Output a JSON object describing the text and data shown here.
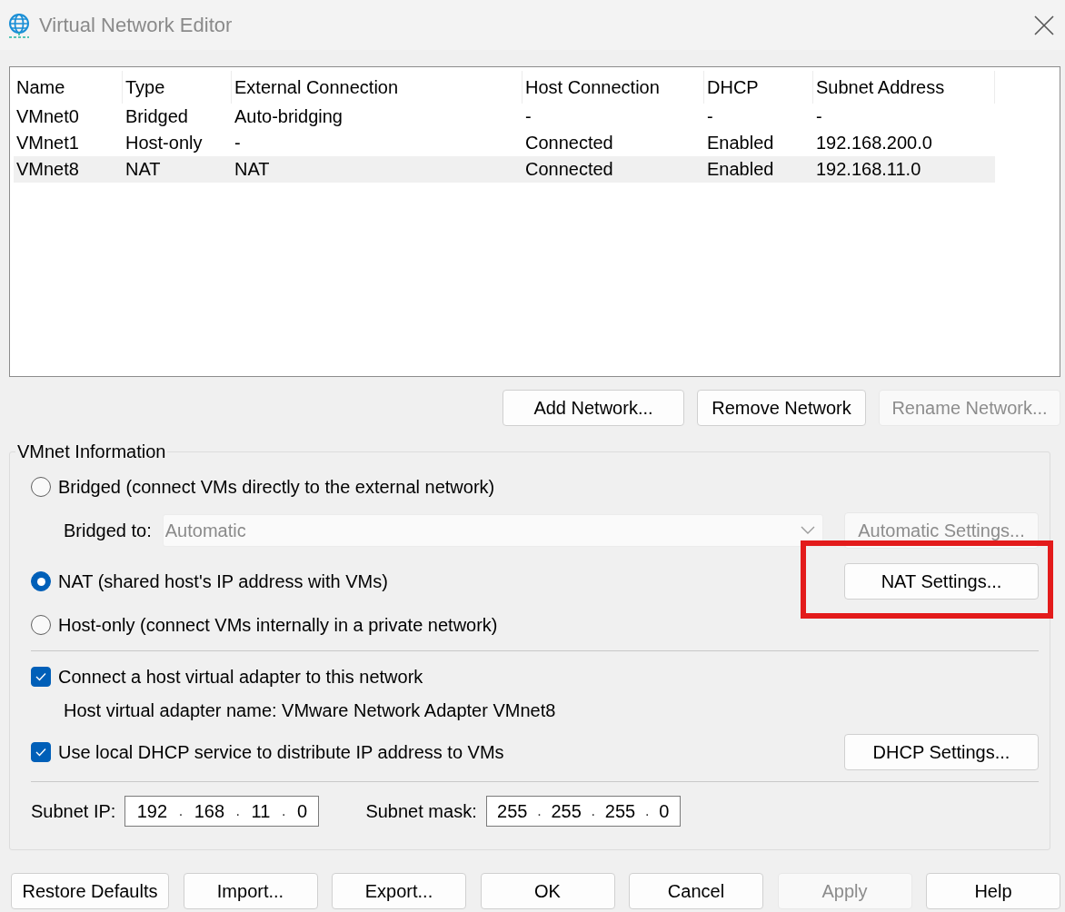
{
  "window": {
    "title": "Virtual Network Editor"
  },
  "networks": {
    "columns": [
      "Name",
      "Type",
      "External Connection",
      "Host Connection",
      "DHCP",
      "Subnet Address"
    ],
    "rows": [
      {
        "cells": [
          "VMnet0",
          "Bridged",
          "Auto-bridging",
          "-",
          "-",
          "-"
        ],
        "selected": false
      },
      {
        "cells": [
          "VMnet1",
          "Host-only",
          "-",
          "Connected",
          "Enabled",
          "192.168.200.0"
        ],
        "selected": false
      },
      {
        "cells": [
          "VMnet8",
          "NAT",
          "NAT",
          "Connected",
          "Enabled",
          "192.168.11.0"
        ],
        "selected": true
      }
    ]
  },
  "network_buttons": [
    {
      "label": "Add Network...",
      "disabled": false
    },
    {
      "label": "Remove Network",
      "disabled": false
    },
    {
      "label": "Rename Network...",
      "disabled": true
    }
  ],
  "vmnet_information": {
    "title": "VMnet Information",
    "modes": [
      {
        "kind": "bridged",
        "label": "Bridged (connect VMs directly to the external network)",
        "selected": false
      },
      {
        "kind": "nat",
        "label": "NAT (shared host's IP address with VMs)",
        "selected": true
      },
      {
        "kind": "host_only",
        "label": "Host-only (connect VMs internally in a private network)",
        "selected": false
      }
    ],
    "bridged_to": {
      "label": "Bridged to:",
      "value": "Automatic",
      "disabled": true
    },
    "automatic_settings_button": {
      "label": "Automatic Settings...",
      "disabled": true
    },
    "nat_settings_button": {
      "label": "NAT Settings...",
      "disabled": false,
      "highlighted": true
    },
    "connect_host_adapter": {
      "label": "Connect a host virtual adapter to this network",
      "checked": true
    },
    "adapter_name": "Host virtual adapter name: VMware Network Adapter VMnet8",
    "use_dhcp": {
      "label": "Use local DHCP service to distribute IP address to VMs",
      "checked": true
    },
    "dhcp_settings_button": {
      "label": "DHCP Settings...",
      "disabled": false
    },
    "subnet_ip": {
      "label": "Subnet IP:",
      "octets": [
        "192",
        "168",
        "11",
        "0"
      ],
      "separator": "."
    },
    "subnet_mask": {
      "label": "Subnet mask:",
      "octets": [
        "255",
        "255",
        "255",
        "0"
      ],
      "separator": "."
    }
  },
  "dialog_buttons": [
    {
      "label": "Restore Defaults",
      "disabled": false
    },
    {
      "label": "Import...",
      "disabled": false
    },
    {
      "label": "Export...",
      "disabled": false
    },
    {
      "label": "OK",
      "disabled": false
    },
    {
      "label": "Cancel",
      "disabled": false
    },
    {
      "label": "Apply",
      "disabled": true
    },
    {
      "label": "Help",
      "disabled": false
    }
  ]
}
